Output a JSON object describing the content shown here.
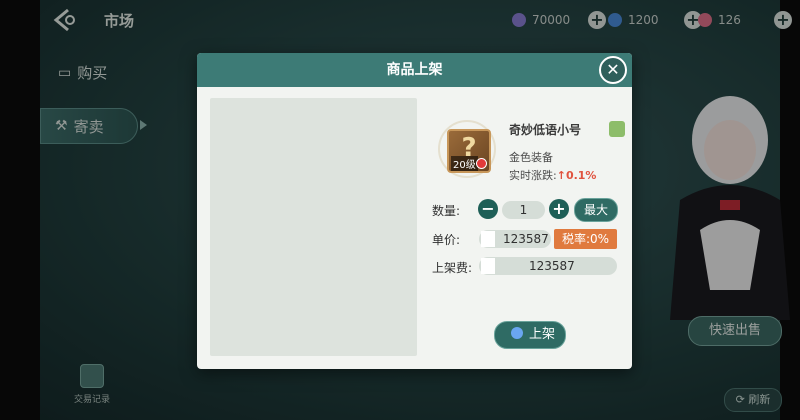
{
  "header": {
    "title": "市场"
  },
  "resources": [
    {
      "name": "purple-gem",
      "value": "70000",
      "color": "#8b7fd6"
    },
    {
      "name": "blue-gem",
      "value": "1200",
      "color": "#4a8cdc"
    },
    {
      "name": "pink-gem",
      "value": "126",
      "color": "#e0708a"
    }
  ],
  "plus_label": "+",
  "sidebar": {
    "items": [
      {
        "label": "购买"
      },
      {
        "label": "寄卖"
      }
    ],
    "trade_record": "交易记录"
  },
  "right": {
    "quick_sell": "快速出售",
    "refresh": "刷新"
  },
  "modal": {
    "title": "商品上架",
    "close": "✕",
    "item": {
      "name": "奇妙低语小号",
      "type": "金色装备",
      "change_prefix": "实时涨跌:",
      "change_arrow": "↑",
      "change_value": "0.1%",
      "level": "20级",
      "icon_glyph": "?"
    },
    "quantity": {
      "label": "数量:",
      "minus": "−",
      "plus": "+",
      "value": "1",
      "max": "最大"
    },
    "unit_price": {
      "label": "单价:",
      "value": "123587",
      "tax": "税率:0%"
    },
    "listing_fee": {
      "label": "上架费:",
      "value": "123587"
    },
    "list_button": "上架"
  }
}
